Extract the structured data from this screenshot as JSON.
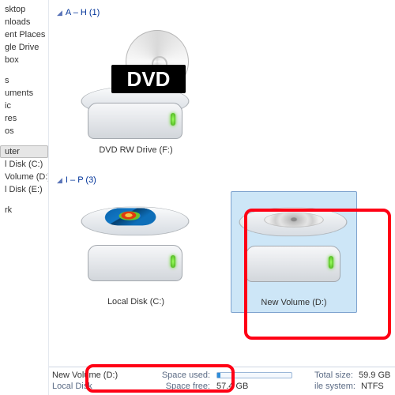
{
  "sidebar": {
    "items": [
      {
        "label": "sktop"
      },
      {
        "label": "nloads"
      },
      {
        "label": "ent Places"
      },
      {
        "label": "gle Drive"
      },
      {
        "label": "box"
      }
    ],
    "section2": [
      {
        "label": "s"
      },
      {
        "label": "uments"
      },
      {
        "label": "ic"
      },
      {
        "label": "res"
      },
      {
        "label": "os"
      }
    ],
    "section3": [
      {
        "label": "uter"
      },
      {
        "label": "l Disk (C:)"
      },
      {
        "label": "Volume (D:)"
      },
      {
        "label": "l Disk (E:)"
      }
    ],
    "section4": [
      {
        "label": "rk"
      }
    ]
  },
  "groups": {
    "ah": {
      "label": "A – H (1)"
    },
    "ip": {
      "label": "I – P (3)"
    }
  },
  "drives": {
    "dvd": {
      "label": "DVD RW Drive (F:)",
      "badge": "DVD"
    },
    "c": {
      "label": "Local Disk (C:)"
    },
    "d": {
      "label": "New Volume (D:)"
    }
  },
  "status": {
    "title": "New Volume (D:)",
    "type": "Local Disk",
    "used_label": "Space used:",
    "free_label": "Space free:",
    "free_value": "57.4 GB",
    "total_label": "Total size:",
    "total_value": "59.9 GB",
    "fs_label": "ile system:",
    "fs_value": "NTFS",
    "used_pct": 4
  }
}
